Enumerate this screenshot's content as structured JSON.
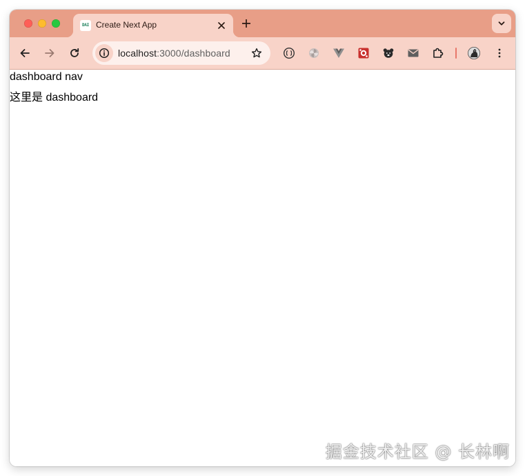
{
  "browser": {
    "tab": {
      "favicon_text": "DAI",
      "title": "Create Next App"
    },
    "address_bar": {
      "host": "localhost",
      "path": ":3000/dashboard"
    },
    "extensions": [
      "code-brackets-icon",
      "pinwheel-icon",
      "vue-icon",
      "red-app-icon",
      "bear-icon",
      "mail-icon",
      "puzzle-piece-icon"
    ],
    "colors": {
      "tabstrip": "#e89e87",
      "active_tab": "#f8d3c8",
      "toolbar": "#f8d3c8",
      "omnibox": "#fdf0ec",
      "separator": "#e8776a"
    }
  },
  "page": {
    "nav_text": "dashboard nav",
    "body_text": "这里是 dashboard"
  },
  "watermark": {
    "text": "掘金技术社区 @ 长林啊"
  }
}
